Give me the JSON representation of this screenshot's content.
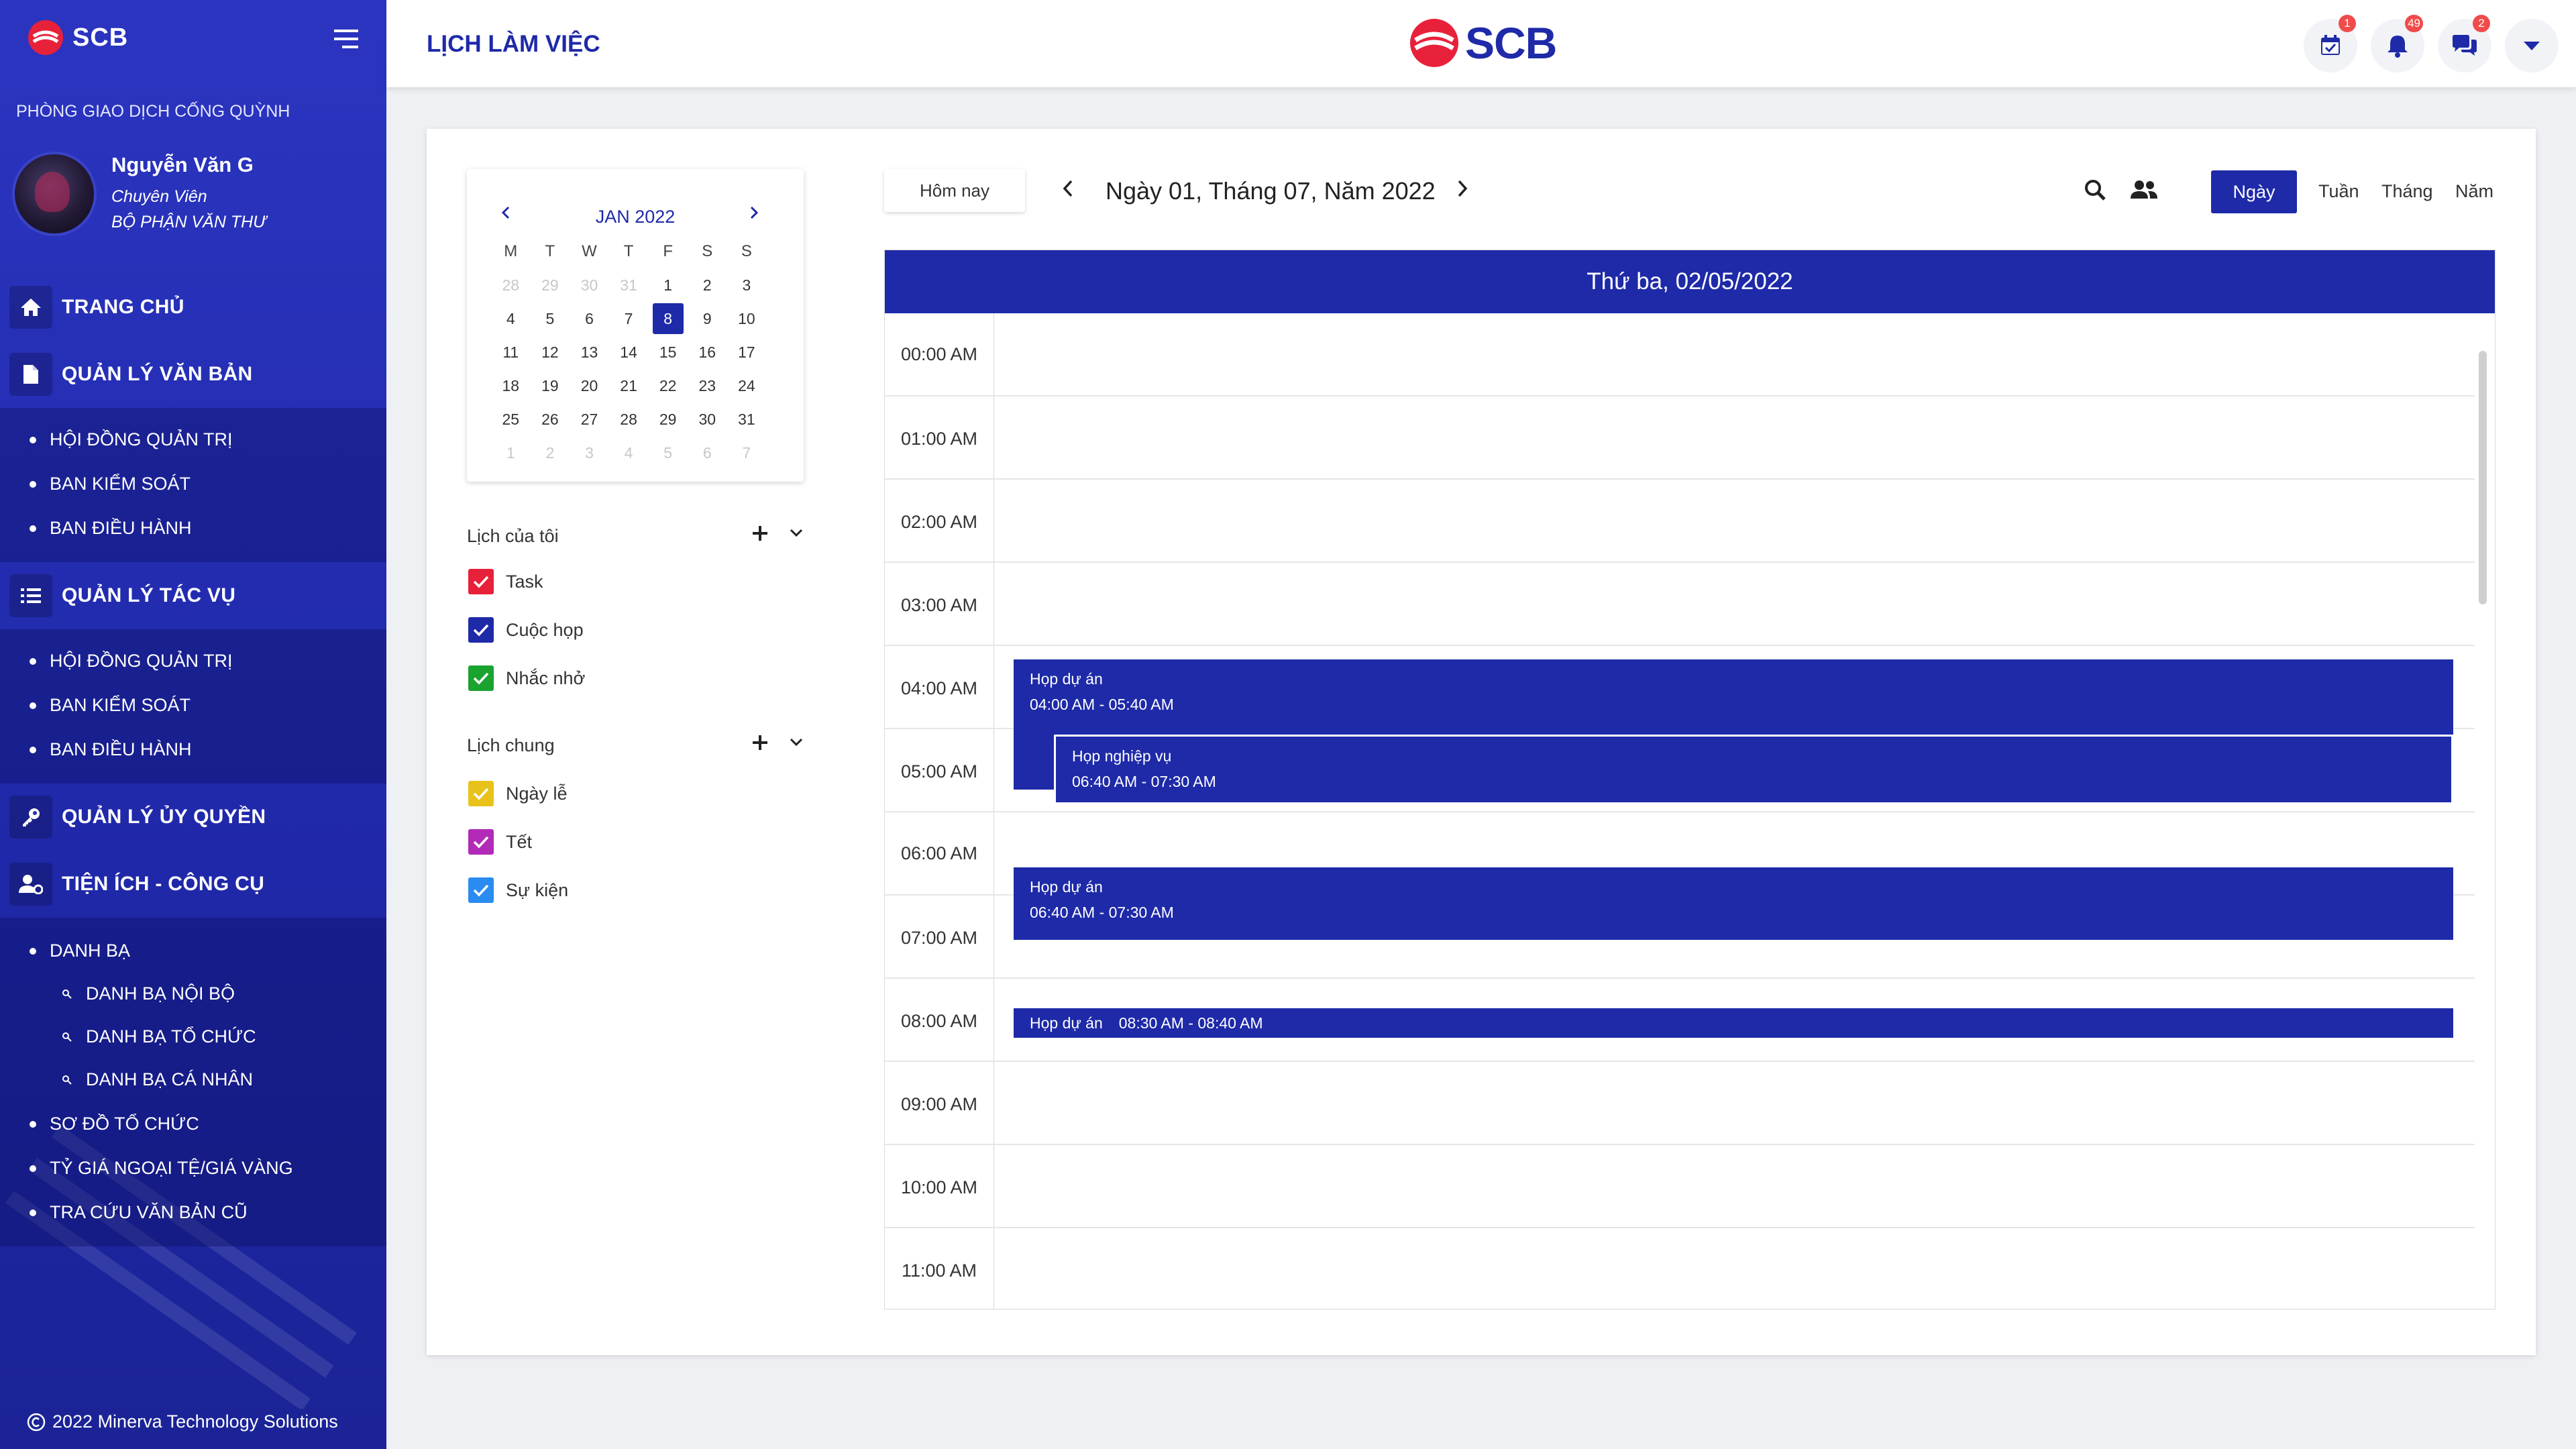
{
  "sidebar": {
    "logo_text": "SCB",
    "branch": "PHÒNG GIAO DỊCH CỐNG QUỲNH",
    "user": {
      "name": "Nguyễn Văn G",
      "role": "Chuyên Viên",
      "department": "BỘ PHẬN VĂN THƯ"
    },
    "sections": {
      "home": "TRANG CHỦ",
      "documents": "QUẢN LÝ VĂN BẢN",
      "tasks": "QUẢN LÝ TÁC VỤ",
      "delegation": "QUẢN LÝ ỦY QUYỀN",
      "utilities": "TIỆN ÍCH - CÔNG CỤ"
    },
    "documents_items": [
      "HỘI ĐỒNG QUẢN TRỊ",
      "BAN KIỂM SOÁT",
      "BAN ĐIỀU HÀNH"
    ],
    "tasks_items": [
      "HỘI ĐỒNG QUẢN TRỊ",
      "BAN KIỂM SOÁT",
      "BAN ĐIỀU HÀNH"
    ],
    "utilities_items": {
      "directory": "DANH BẠ",
      "directory_sub": [
        "DANH BẠ NỘI BỘ",
        "DANH BẠ TỔ CHỨC",
        "DANH BẠ CÁ NHÂN"
      ],
      "org_chart": "SƠ ĐỒ TỔ CHỨC",
      "exchange_rate": "TỶ GIÁ NGOẠI TỆ/GIÁ VÀNG",
      "old_docs": "TRA CỨU VĂN BẢN CŨ"
    },
    "footer": "2022 Minerva Technology Solutions"
  },
  "header": {
    "title": "LỊCH LÀM VIỆC",
    "logo_text": "SCB",
    "badges": {
      "calendar": "1",
      "notifications": "49",
      "messages": "2"
    }
  },
  "mini_calendar": {
    "month_label": "JAN 2022",
    "weekdays": [
      "M",
      "T",
      "W",
      "T",
      "F",
      "S",
      "S"
    ],
    "days": [
      [
        "28",
        "29",
        "30",
        "31",
        "1",
        "2",
        "3"
      ],
      [
        "4",
        "5",
        "6",
        "7",
        "8",
        "9",
        "10"
      ],
      [
        "11",
        "12",
        "13",
        "14",
        "15",
        "16",
        "17"
      ],
      [
        "18",
        "19",
        "20",
        "21",
        "22",
        "23",
        "24"
      ],
      [
        "25",
        "26",
        "27",
        "28",
        "29",
        "30",
        "31"
      ],
      [
        "1",
        "2",
        "3",
        "4",
        "5",
        "6",
        "7"
      ]
    ],
    "selected_day": "8"
  },
  "my_calendars": {
    "title": "Lịch của tôi",
    "items": [
      {
        "label": "Task",
        "color": "#e8213a",
        "checked": true
      },
      {
        "label": "Cuộc họp",
        "color": "#1e2aa8",
        "checked": true
      },
      {
        "label": "Nhắc nhở",
        "color": "#1aa32e",
        "checked": true
      }
    ]
  },
  "shared_calendars": {
    "title": "Lịch chung",
    "items": [
      {
        "label": "Ngày lễ",
        "color": "#e8c21a",
        "checked": true
      },
      {
        "label": "Tết",
        "color": "#b32ab8",
        "checked": true
      },
      {
        "label": "Sự kiện",
        "color": "#2a8cf0",
        "checked": true
      }
    ]
  },
  "toolbar": {
    "today_label": "Hôm nay",
    "date_title": "Ngày 01, Tháng 07, Năm 2022",
    "views": {
      "day": "Ngày",
      "week": "Tuần",
      "month": "Tháng",
      "year": "Năm"
    }
  },
  "day_view": {
    "header": "Thứ ba, 02/05/2022",
    "hours": [
      "00:00 AM",
      "01:00 AM",
      "02:00 AM",
      "03:00 AM",
      "04:00 AM",
      "05:00 AM",
      "06:00 AM",
      "07:00 AM",
      "08:00 AM",
      "09:00 AM",
      "10:00 AM",
      "11:00 AM"
    ],
    "events": [
      {
        "title": "Họp dự án",
        "time": "04:00 AM - 05:40 AM"
      },
      {
        "title": "Họp nghiệp vụ",
        "time": "06:40 AM - 07:30 AM"
      },
      {
        "title": "Họp dự án",
        "time": "06:40 AM - 07:30 AM"
      },
      {
        "title": "Họp dự án",
        "time": "08:30 AM - 08:40 AM"
      }
    ]
  },
  "colors": {
    "brand": "#1e2aa8",
    "sidebar": "#2530b4",
    "badge": "#f04b4b",
    "logo_red": "#e8213a"
  }
}
